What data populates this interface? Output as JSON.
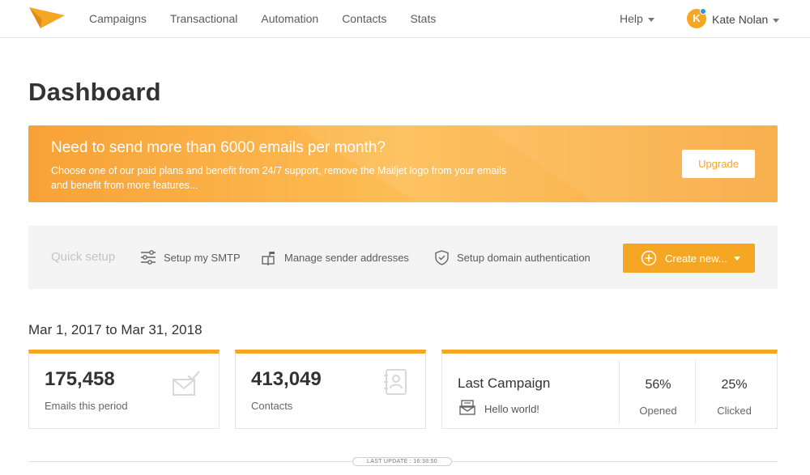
{
  "nav": {
    "items": [
      {
        "label": "Campaigns"
      },
      {
        "label": "Transactional"
      },
      {
        "label": "Automation"
      },
      {
        "label": "Contacts"
      },
      {
        "label": "Stats"
      }
    ],
    "help_label": "Help",
    "user": {
      "initial": "K",
      "name": "Kate Nolan"
    }
  },
  "page": {
    "title": "Dashboard"
  },
  "banner": {
    "title": "Need to send more than 6000 emails per month?",
    "text": "Choose one of our paid plans and benefit from 24/7 support, remove the Mailjet logo from your emails and benefit from more features...",
    "button_label": "Upgrade"
  },
  "quick_setup": {
    "label": "Quick setup",
    "items": [
      {
        "label": "Setup my SMTP",
        "icon": "sliders-icon"
      },
      {
        "label": "Manage sender addresses",
        "icon": "mailbox-icon"
      },
      {
        "label": "Setup domain authentication",
        "icon": "shield-check-icon"
      }
    ],
    "create_label": "Create new..."
  },
  "stats": {
    "date_range": "Mar 1, 2017 to Mar 31, 2018",
    "emails": {
      "value": "175,458",
      "label": "Emails this period"
    },
    "contacts": {
      "value": "413,049",
      "label": "Contacts"
    },
    "last_campaign": {
      "title": "Last Campaign",
      "name": "Hello world!",
      "opened": {
        "value": "56%",
        "label": "Opened"
      },
      "clicked": {
        "value": "25%",
        "label": "Clicked"
      }
    }
  },
  "footer": {
    "last_update": "LAST UPDATE : 16:38:50"
  },
  "colors": {
    "accent": "#f5a623",
    "banner_start": "#f7a236",
    "banner_mid": "#fdbd55"
  }
}
